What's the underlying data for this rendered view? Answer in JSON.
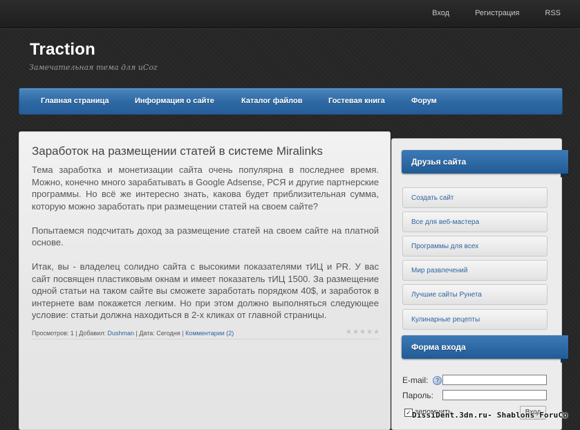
{
  "top_links": [
    "Вход",
    "Регистрация",
    "RSS"
  ],
  "site": {
    "logo": "Traction",
    "slogan": "Замечательная тема для uCoz"
  },
  "nav": [
    "Главная страница",
    "Информация о сайте",
    "Каталог файлов",
    "Гостевая книга",
    "Форум"
  ],
  "post": {
    "title": "Заработок на размещении статей в системе Miralinks",
    "paragraphs": [
      "Тема заработка и монетизации сайта очень популярна в последнее время. Можно, конечно много зарабатывать в Google Adsense, РСЯ и другие партнерские программы. Но всё же интересно знать, какова будет приблизительная сумма, которую можно заработать при размещении статей на своем сайте?",
      "Попытаемся подсчитать доход за размещение статей на своем сайте на платной основе.",
      "Итак, вы - владелец солидно сайта с высокими показателями тИЦ и PR. У вас сайт посвящен пластиковым окнам и имеет показатель тИЦ 1500. За размещение одной статьи на таком сайте вы сможете заработать порядком 40$, и заработок в интернете вам покажется легким. Но при этом должно выполняться следующее условие: статьи должна находиться в 2-х кликах от главной страницы."
    ],
    "meta": {
      "views_label": "Просмотров: 1 | Добавил: ",
      "author": "Dushman",
      "date_label": " | Дата: Сегодня | ",
      "comments": "Комментарии (2)"
    },
    "rating": 0
  },
  "sidebar": {
    "friends_title": "Друзья сайта",
    "friends": [
      "Создать сайт",
      "Все для веб-мастера",
      "Программы для всех",
      "Мир развлечений",
      "Лучшие сайты Рунета",
      "Кулинарные рецепты"
    ],
    "login_title": "Форма входа",
    "email_label": "E-mail:",
    "password_label": "Пароль:",
    "remember_label": "запомнить",
    "login_button": "Вход"
  },
  "watermark": "DissiDent.3dn.ru- Shablons ForuCo"
}
